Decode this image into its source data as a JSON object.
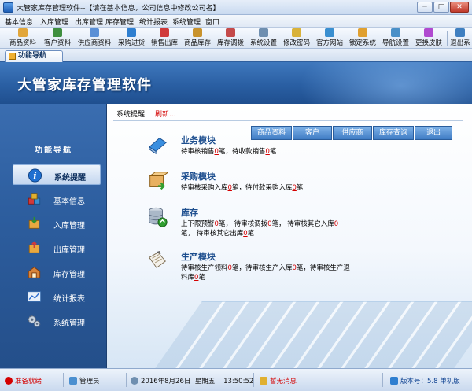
{
  "window": {
    "title": "大管家库存管理软件--【请在基本信息，公司信息中修改公司名】",
    "minimize": "─",
    "maximize": "□",
    "close": "✕"
  },
  "menu": [
    "基本信息",
    "入库管理",
    "出库管理",
    "库存管理",
    "统计报表",
    "系统管理",
    "窗口"
  ],
  "toolbar": {
    "items": [
      {
        "label": "商品资料",
        "icon": "goods-icon",
        "color": "#e2a63a"
      },
      {
        "label": "客户资料",
        "icon": "customer-icon",
        "color": "#3f8f3f"
      },
      {
        "label": "供应商资料",
        "icon": "supplier-icon",
        "color": "#5a8fd6"
      },
      {
        "label": "采购进货",
        "icon": "purchase-icon",
        "color": "#2f7fd0"
      },
      {
        "label": "销售出库",
        "icon": "sales-icon",
        "color": "#d03a3a"
      },
      {
        "label": "商品库存",
        "icon": "stock-icon",
        "color": "#c9932d"
      },
      {
        "label": "库存调拨",
        "icon": "transfer-icon",
        "color": "#c44a4a"
      },
      {
        "label": "系统设置",
        "icon": "settings-icon",
        "color": "#6f8fb0"
      },
      {
        "label": "修改密码",
        "icon": "password-icon",
        "color": "#d9b23a"
      },
      {
        "label": "官方网站",
        "icon": "website-icon",
        "color": "#3a8fd0"
      },
      {
        "label": "锁定系统",
        "icon": "lock-icon",
        "color": "#e0a030"
      },
      {
        "label": "导航设置",
        "icon": "navigation-icon",
        "color": "#4a90c8"
      },
      {
        "label": "更换皮肤",
        "icon": "skin-icon",
        "color": "#b04ad0"
      },
      {
        "label": "退出系",
        "icon": "exit-icon",
        "color": "#3f7fc0"
      }
    ]
  },
  "tab": {
    "label": "功能导航"
  },
  "banner": {
    "title": "大管家库存管理软件"
  },
  "sidebar": {
    "heading": "功能导航",
    "items": [
      {
        "label": "系统提醒",
        "icon": "info-icon",
        "active": true
      },
      {
        "label": "基本信息",
        "icon": "cubes-icon",
        "active": false
      },
      {
        "label": "入库管理",
        "icon": "inbound-box-icon",
        "active": false
      },
      {
        "label": "出库管理",
        "icon": "outbound-box-icon",
        "active": false
      },
      {
        "label": "库存管理",
        "icon": "warehouse-icon",
        "active": false
      },
      {
        "label": "统计报表",
        "icon": "report-chart-icon",
        "active": false
      },
      {
        "label": "系统管理",
        "icon": "gears-icon",
        "active": false
      }
    ]
  },
  "main": {
    "breadcrumb": "系统提醒",
    "refresh": "刷新...",
    "quick_buttons": [
      "商品资料",
      "客户",
      "供应商",
      "库存查询",
      "退出"
    ],
    "modules": [
      {
        "title": "业务模块",
        "icon": "book-icon",
        "line1": {
          "a": "待审核销售",
          "n1": "0",
          "b": "笔，待收款销售",
          "n2": "0",
          "c": "笔"
        }
      },
      {
        "title": "采购模块",
        "icon": "purchase-box-icon",
        "line1": {
          "a": "待审核采购入库",
          "n1": "0",
          "b": "笔，待付款采购入库",
          "n2": "0",
          "c": "笔"
        }
      },
      {
        "title": "库存",
        "icon": "database-icon",
        "line1": {
          "a": "上下限预警",
          "n1": "0",
          "b": "笔，  待审核调拨",
          "n2": "0",
          "c": "笔，  待审核其它入库",
          "n3": "0"
        },
        "line2": {
          "a": "笔，  待审核其它出库",
          "n1": "0",
          "b": "笔"
        }
      },
      {
        "title": "生产模块",
        "icon": "clipboard-icon",
        "line1": {
          "a": "待审核生产领料",
          "n1": "0",
          "b": "笔，待审核生产入库",
          "n2": "0",
          "c": "笔，待审核生产退"
        },
        "line2": {
          "a": "料库",
          "n1": "0",
          "b": "笔"
        }
      }
    ]
  },
  "status": {
    "ready": "准备就绪",
    "user": "管理员",
    "date": "2016年8月26日",
    "weekday": "星期五",
    "time": "13:50:52",
    "message": "暂无消息",
    "version": "版本号：5.8 单机版"
  },
  "colors": {
    "accent": "#2a5fa3",
    "alert": "#d40000"
  }
}
